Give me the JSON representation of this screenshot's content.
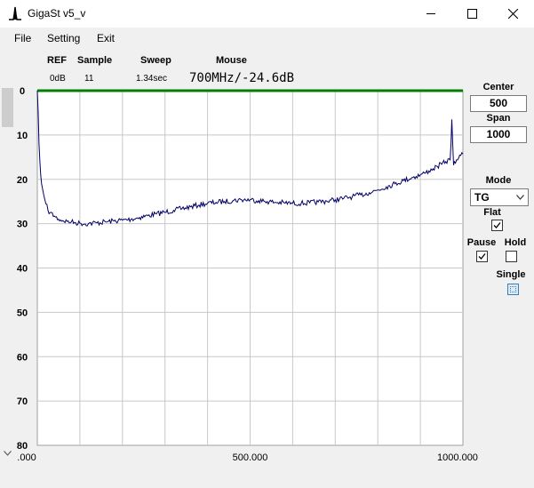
{
  "window": {
    "title": "GigaSt v5_v"
  },
  "menu": [
    "File",
    "Setting",
    "Exit"
  ],
  "status": {
    "headers": [
      "REF",
      "Sample",
      "Sweep",
      "Mouse"
    ],
    "ref": "0dB",
    "sample": "11",
    "sweep": "1.34sec",
    "mouse": "700MHz/-24.6dB"
  },
  "controls": {
    "center_label": "Center",
    "center_value": "500",
    "span_label": "Span",
    "span_value": "1000",
    "mode_label": "Mode",
    "mode_value": "TG",
    "flat_label": "Flat",
    "flat_checked": true,
    "pause_label": "Pause",
    "pause_checked": true,
    "hold_label": "Hold",
    "hold_checked": false,
    "single_label": "Single"
  },
  "chart_data": {
    "type": "line",
    "x_tick_labels": [
      ".000",
      "500.000",
      "1000.000"
    ],
    "y_tick_labels": [
      "0",
      "10",
      "20",
      "30",
      "40",
      "50",
      "60",
      "70",
      "80"
    ],
    "xlim": [
      0,
      1000
    ],
    "ylim": [
      0,
      80
    ],
    "y_inverted": true,
    "grid": true,
    "x_grid_divisions": 10,
    "y_grid_divisions": 8,
    "reference_line": {
      "y": 0,
      "color": "#008000"
    },
    "trace_color": "#000066",
    "series": [
      {
        "x": [
          0,
          2,
          4,
          6,
          8,
          10,
          15,
          20,
          25,
          30,
          40,
          50,
          60,
          70,
          80,
          90,
          100,
          120,
          140,
          160,
          180,
          200,
          220,
          240,
          260,
          280,
          300,
          320,
          340,
          360,
          380,
          400,
          420,
          440,
          460,
          480,
          500,
          520,
          540,
          560,
          580,
          600,
          620,
          640,
          660,
          680,
          700,
          720,
          740,
          760,
          780,
          800,
          820,
          840,
          860,
          880,
          900,
          910,
          920,
          930,
          940,
          950,
          960,
          970,
          972,
          974,
          976,
          978,
          980,
          985,
          990,
          995,
          1000
        ],
        "y": [
          0,
          5,
          12,
          16,
          19,
          21,
          23.5,
          25.5,
          27,
          27.5,
          28.3,
          29,
          29.3,
          29.5,
          29.6,
          29.8,
          29.9,
          30,
          29.8,
          29.6,
          29.4,
          29.2,
          29,
          28.6,
          28.2,
          27.8,
          27.4,
          27,
          26.6,
          26.2,
          25.8,
          25.4,
          25.2,
          25,
          24.8,
          24.6,
          24.6,
          24.8,
          25,
          25.2,
          25.3,
          25.4,
          25.4,
          25.3,
          25.1,
          24.9,
          24.6,
          24.3,
          23.9,
          23.5,
          23,
          22.4,
          21.7,
          21,
          20.3,
          19.6,
          19,
          18.6,
          18.1,
          17.6,
          17.1,
          16.6,
          16,
          15.6,
          12,
          6.5,
          12,
          16.8,
          16,
          15.6,
          15.2,
          14.6,
          14.3
        ]
      }
    ]
  }
}
